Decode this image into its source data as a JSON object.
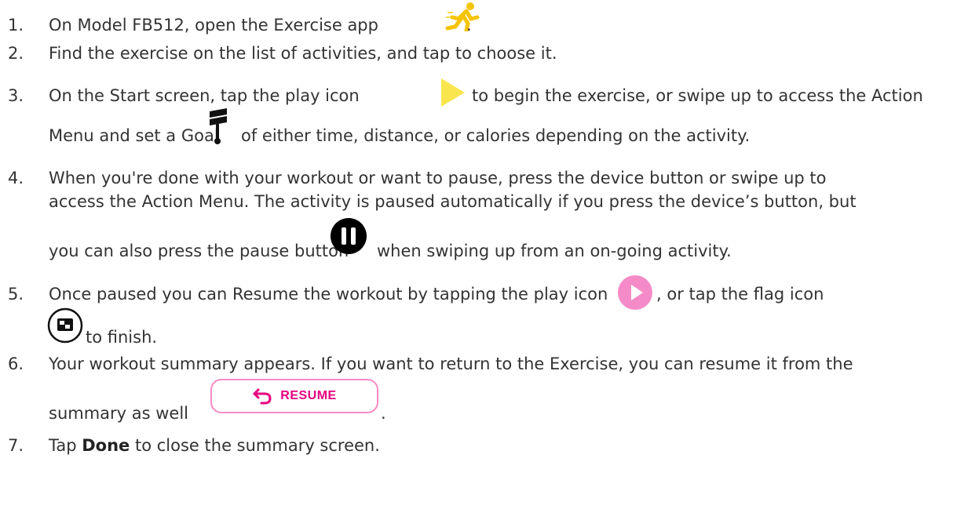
{
  "steps": [
    {
      "num": "1.",
      "text_a": "On Model FB512, open the Exercise app",
      "text_b": "."
    },
    {
      "num": "2.",
      "text_a": "Find the exercise on the list of activities, and tap to choose it."
    },
    {
      "num": "3.",
      "text_a": "On the Start screen, tap the play icon",
      "text_b": "to begin the exercise, or swipe up to access the Action",
      "text_c": "Menu and set a Goal",
      "text_d": "of either time, distance, or calories depending on the activity."
    },
    {
      "num": "4.",
      "text_a": "When you're done with your workout or want to pause, press the device button or swipe up to",
      "text_b": "access the Action Menu. The activity is paused automatically if you press the device’s button, but",
      "text_c": "you can also press the pause button",
      "text_d": "when swiping up from an on-going activity."
    },
    {
      "num": "5.",
      "text_a": "Once paused you can Resume the workout by tapping the play icon",
      "text_b": ", or tap the flag icon",
      "text_c": "to finish."
    },
    {
      "num": "6.",
      "text_a": "Your workout summary appears. If you want to return to the Exercise, you can resume it from the",
      "text_b": "summary as well",
      "text_c": "."
    },
    {
      "num": "7.",
      "text_a": "Tap",
      "text_bold": "Done",
      "text_b": "to close the summary screen."
    }
  ],
  "resume_button": {
    "label": "RESUME"
  },
  "icons": {
    "exercise_app": "running-figure-icon",
    "play_start": "yellow-play-triangle-icon",
    "goal": "goal-flag-icon",
    "pause": "pause-button-icon",
    "play_resume": "pink-play-circle-icon",
    "finish": "finish-flag-icon",
    "resume_arrow": "return-arrow-icon"
  },
  "colors": {
    "text": "#333333",
    "exercise_yellow": "#f5c400",
    "play_yellow": "#f9e64f",
    "resume_pink": "#f48bc8",
    "resume_label_pink": "#e6007e"
  }
}
